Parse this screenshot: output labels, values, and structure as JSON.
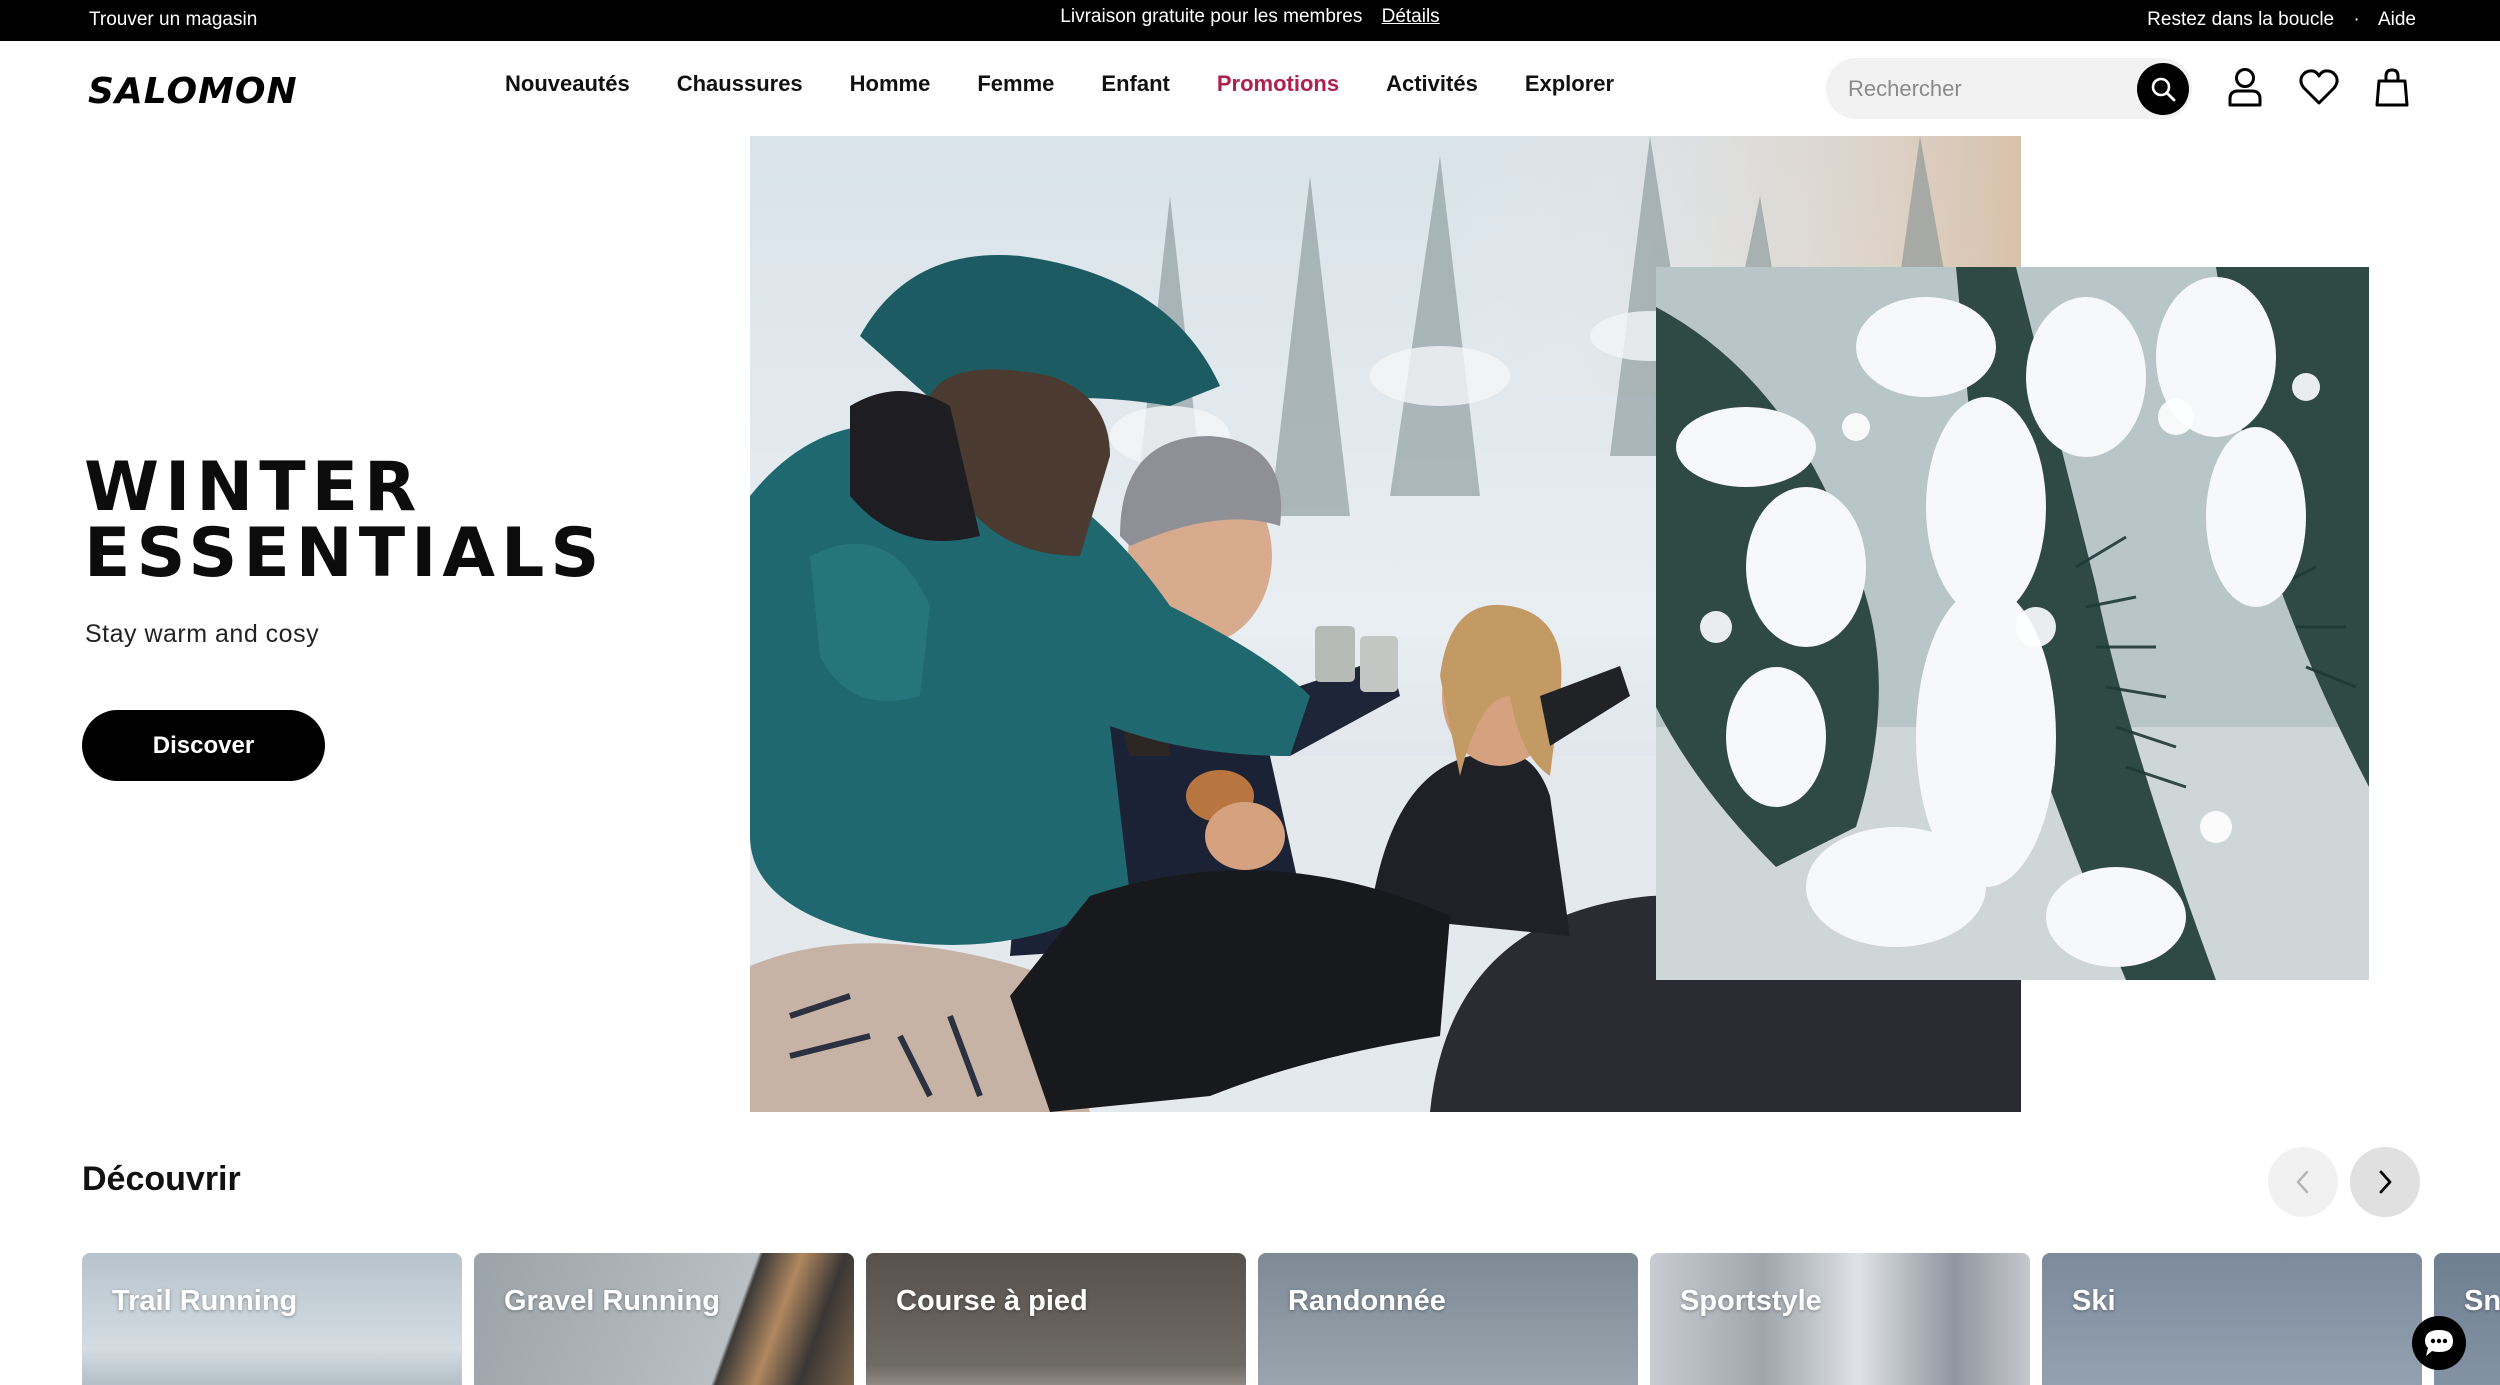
{
  "topbar": {
    "left": "Trouver un magasin",
    "center_text": "Livraison gratuite pour les membres",
    "center_link": "Détails",
    "right_link_1": "Restez dans la boucle",
    "separator": "·",
    "right_link_2": "Aide"
  },
  "header": {
    "logo": "SALOMON",
    "nav": [
      "Nouveautés",
      "Chaussures",
      "Homme",
      "Femme",
      "Enfant",
      "Promotions",
      "Activités",
      "Explorer"
    ],
    "search_placeholder": "Rechercher",
    "icons": [
      "search-icon",
      "account-icon",
      "heart-icon",
      "bag-icon"
    ]
  },
  "hero": {
    "title_line1": "WINTER",
    "title_line2": "ESSENTIALS",
    "subtitle": "Stay warm and cosy",
    "button": "Discover"
  },
  "discover": {
    "title": "Découvrir",
    "cards": [
      "Trail Running",
      "Gravel Running",
      "Course à pied",
      "Randonnée",
      "Sportstyle",
      "Ski",
      "Sno"
    ]
  },
  "colors": {
    "promo": "#b0204e",
    "topbar_bg": "#000000",
    "button_bg": "#000000"
  }
}
